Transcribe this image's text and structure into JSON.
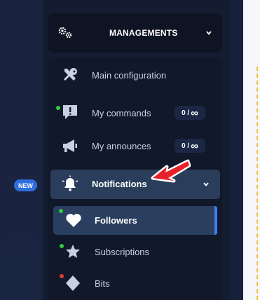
{
  "new_badge": "NEW",
  "managements": {
    "label": "MANAGEMENTS"
  },
  "menu": {
    "main_configuration": "Main configuration",
    "my_commands": "My commands",
    "my_announces": "My announces",
    "notifications": "Notifications",
    "followers": "Followers",
    "subscriptions": "Subscriptions",
    "bits": "Bits"
  },
  "badges": {
    "commands": {
      "count": "0 /",
      "limit": "∞"
    },
    "announces": {
      "count": "0 /",
      "limit": "∞"
    }
  },
  "colors": {
    "accent": "#3d7ff0",
    "highlight_arrow": "#e8202a",
    "status_green": "#2ecc40",
    "status_red": "#e23b3b",
    "dash_line": "#f2c13c"
  }
}
